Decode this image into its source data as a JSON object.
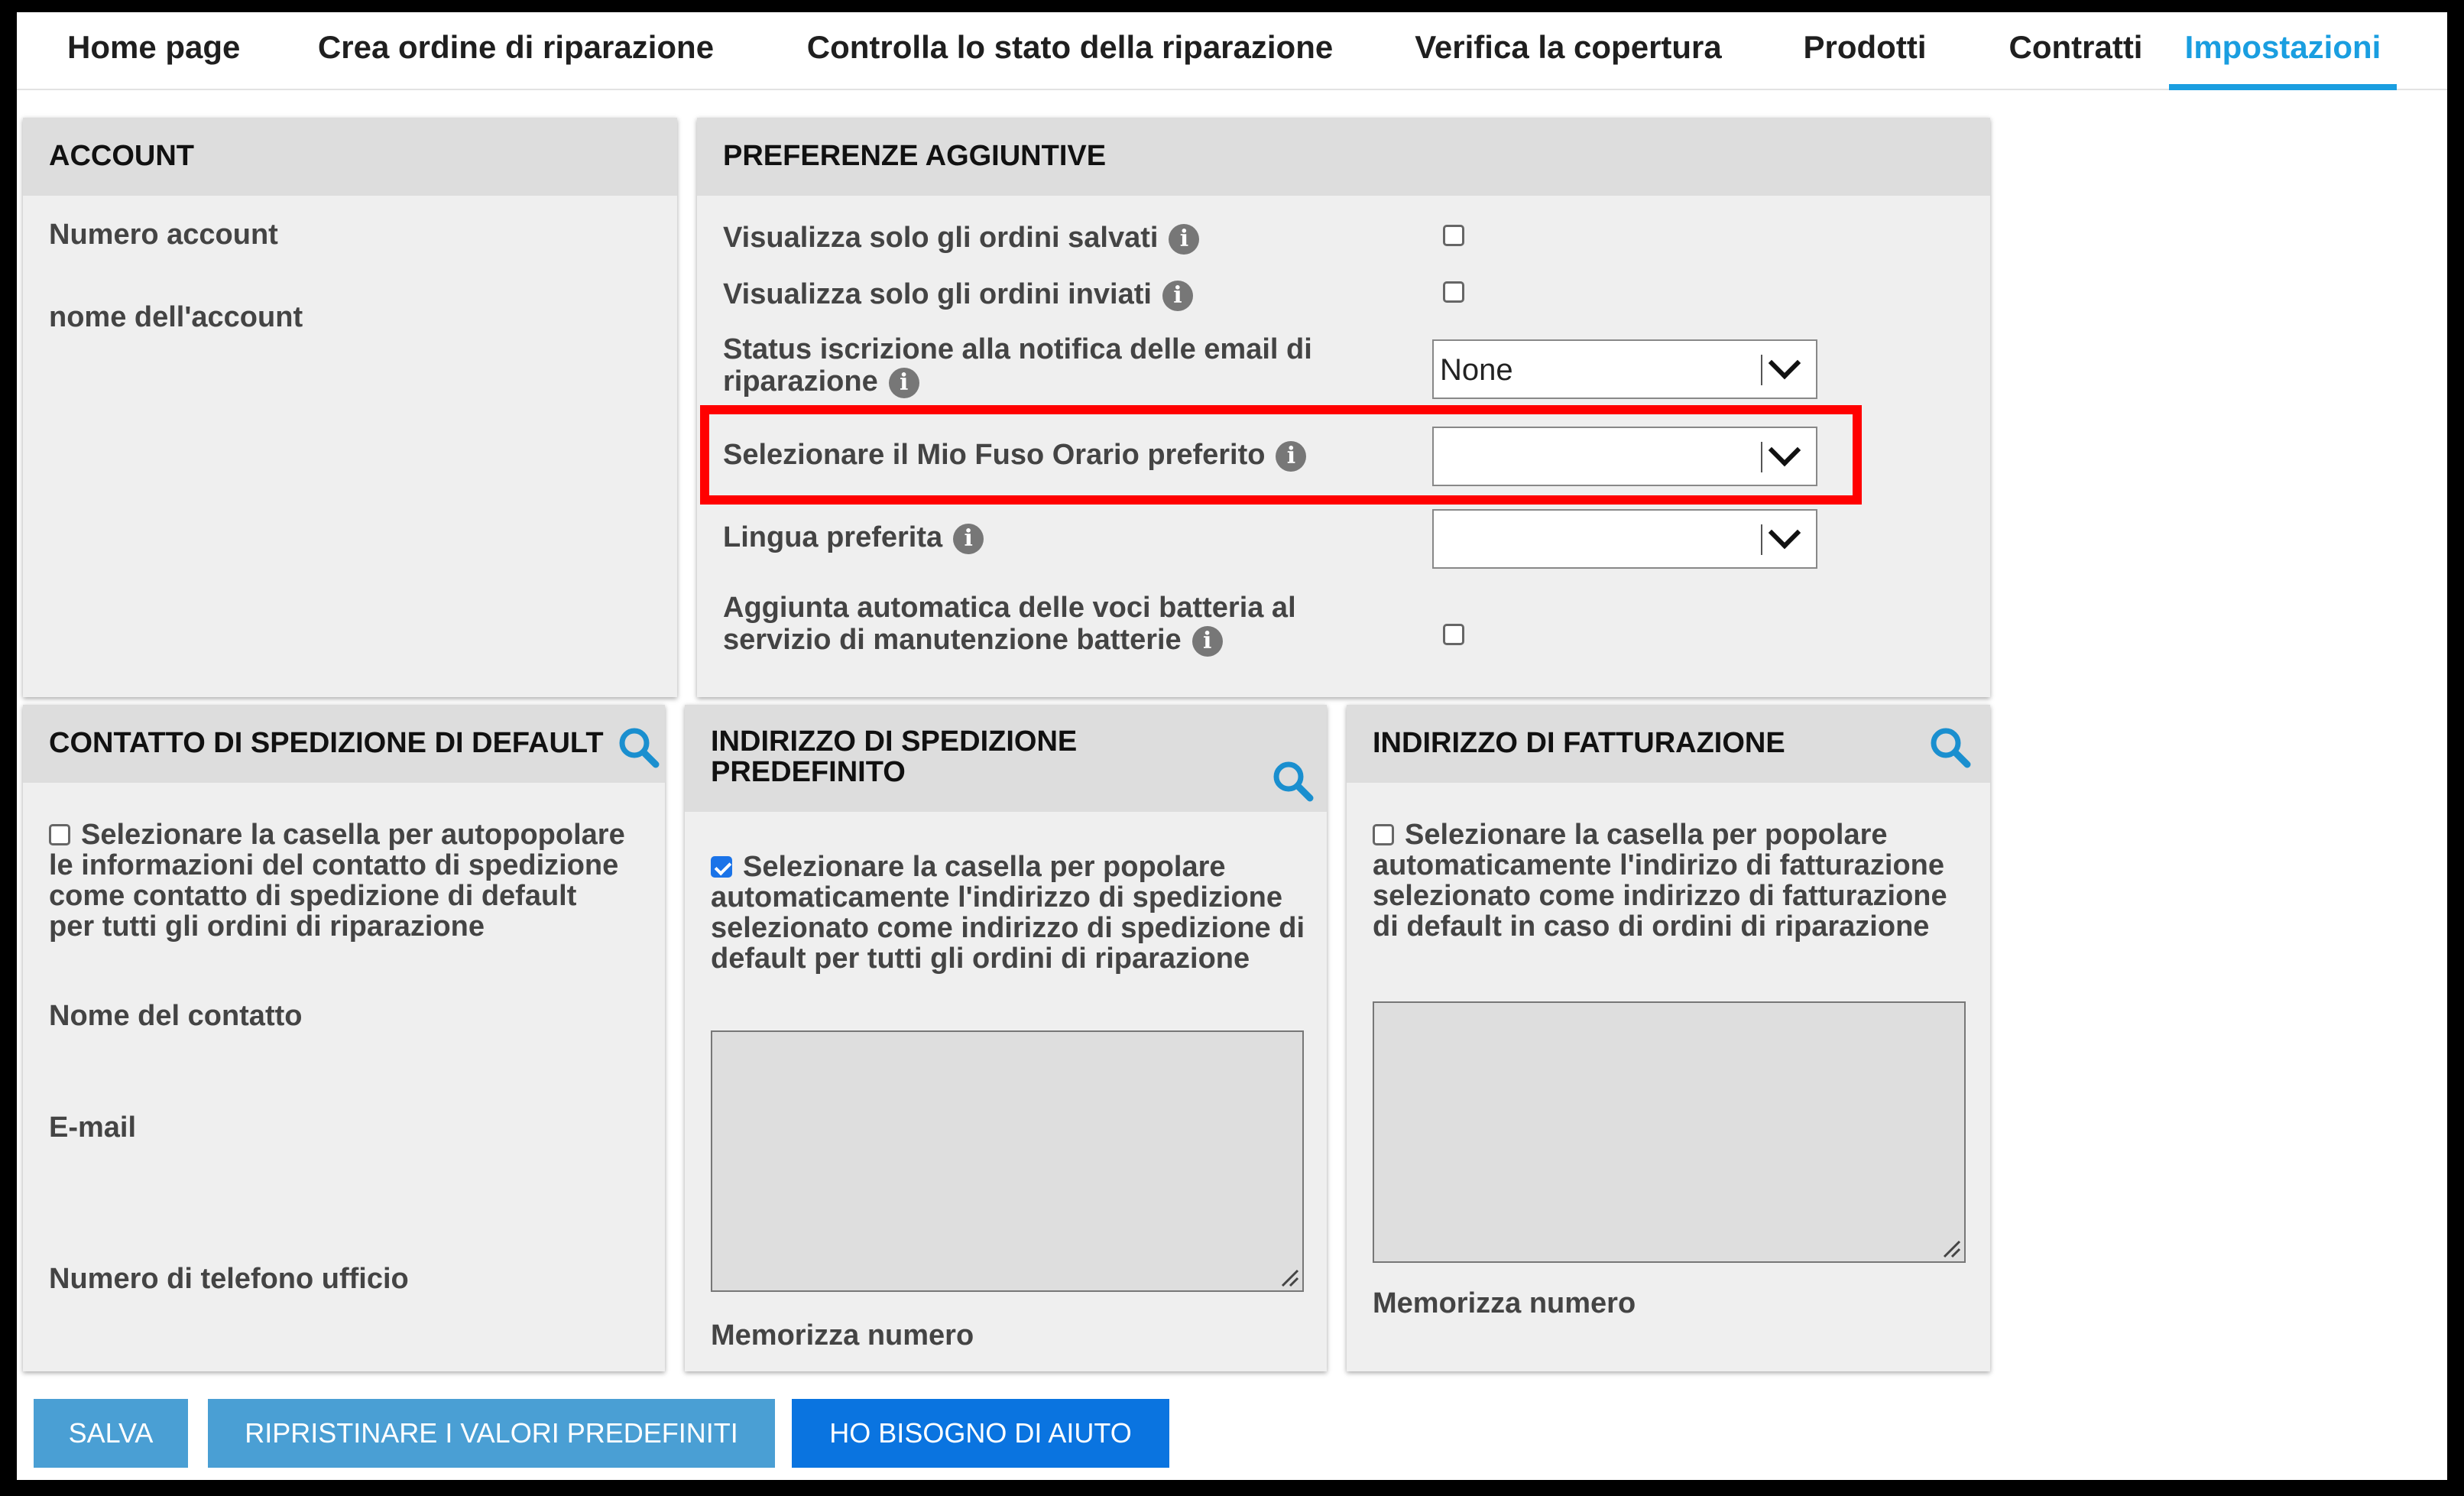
{
  "nav": {
    "tabs": [
      {
        "label": "Home page",
        "active": false
      },
      {
        "label": "Crea ordine di riparazione",
        "active": false
      },
      {
        "label": "Controlla lo stato della riparazione",
        "active": false
      },
      {
        "label": "Verifica la copertura",
        "active": false
      },
      {
        "label": "Prodotti",
        "active": false
      },
      {
        "label": "Contratti",
        "active": false
      },
      {
        "label": "Impostazioni",
        "active": true
      }
    ]
  },
  "account": {
    "title": "ACCOUNT",
    "account_number_label": "Numero account",
    "account_name_label": "nome dell'account"
  },
  "preferences": {
    "title": "PREFERENZE AGGIUNTIVE",
    "saved_only_label": "Visualizza solo gli ordini salvati",
    "saved_only_checked": false,
    "sent_only_label": "Visualizza solo gli ordini inviati",
    "sent_only_checked": false,
    "email_status_label_1": "Status iscrizione alla notifica delle email di",
    "email_status_label_2": "riparazione",
    "email_status_value": "None",
    "timezone_label": "Selezionare il Mio Fuso Orario preferito",
    "timezone_value": "",
    "language_label": "Lingua preferita",
    "language_value": "",
    "battery_label_1": "Aggiunta automatica delle voci batteria al",
    "battery_label_2": "servizio di manutenzione batterie",
    "battery_checked": false
  },
  "shipping_contact": {
    "title": "CONTATTO DI SPEDIZIONE DI DEFAULT",
    "checkbox_text": "Selezionare la casella per autopopolare le informazioni del contatto di spedizione come contatto di spedizione di default per tutti gli ordini di riparazione",
    "checked": false,
    "contact_name_label": "Nome del contatto",
    "email_label": "E-mail",
    "phone_label": "Numero di telefono ufficio"
  },
  "shipping_address": {
    "title": "INDIRIZZO DI SPEDIZIONE PREDEFINITO",
    "checkbox_text": "Selezionare la casella per popolare automaticamente l'indirizzo di spedizione selezionato come indirizzo di spedizione di default per tutti gli ordini di riparazione",
    "checked": true,
    "address_value": "",
    "store_number_label": "Memorizza numero"
  },
  "billing_address": {
    "title": "INDIRIZZO DI FATTURAZIONE",
    "checkbox_text": "Selezionare la casella per popolare automaticamente l'indirizo di fatturazione selezionato come indirizzo di fatturazione di default in caso di ordini di riparazione",
    "checked": false,
    "address_value": "",
    "store_number_label": "Memorizza numero"
  },
  "buttons": {
    "save": "SALVA",
    "reset": "RIPRISTINARE I VALORI PREDEFINITI",
    "help": "HO BISOGNO DI AIUTO"
  },
  "info_glyph": "i",
  "icons": [
    "info-icon",
    "search-icon",
    "chevron-down-icon",
    "resize-grip-icon"
  ],
  "colors": {
    "accent": "#1a9ee0",
    "highlight": "#ff0000",
    "save_button": "#4a9fd4",
    "help_button": "#0a74e0"
  }
}
